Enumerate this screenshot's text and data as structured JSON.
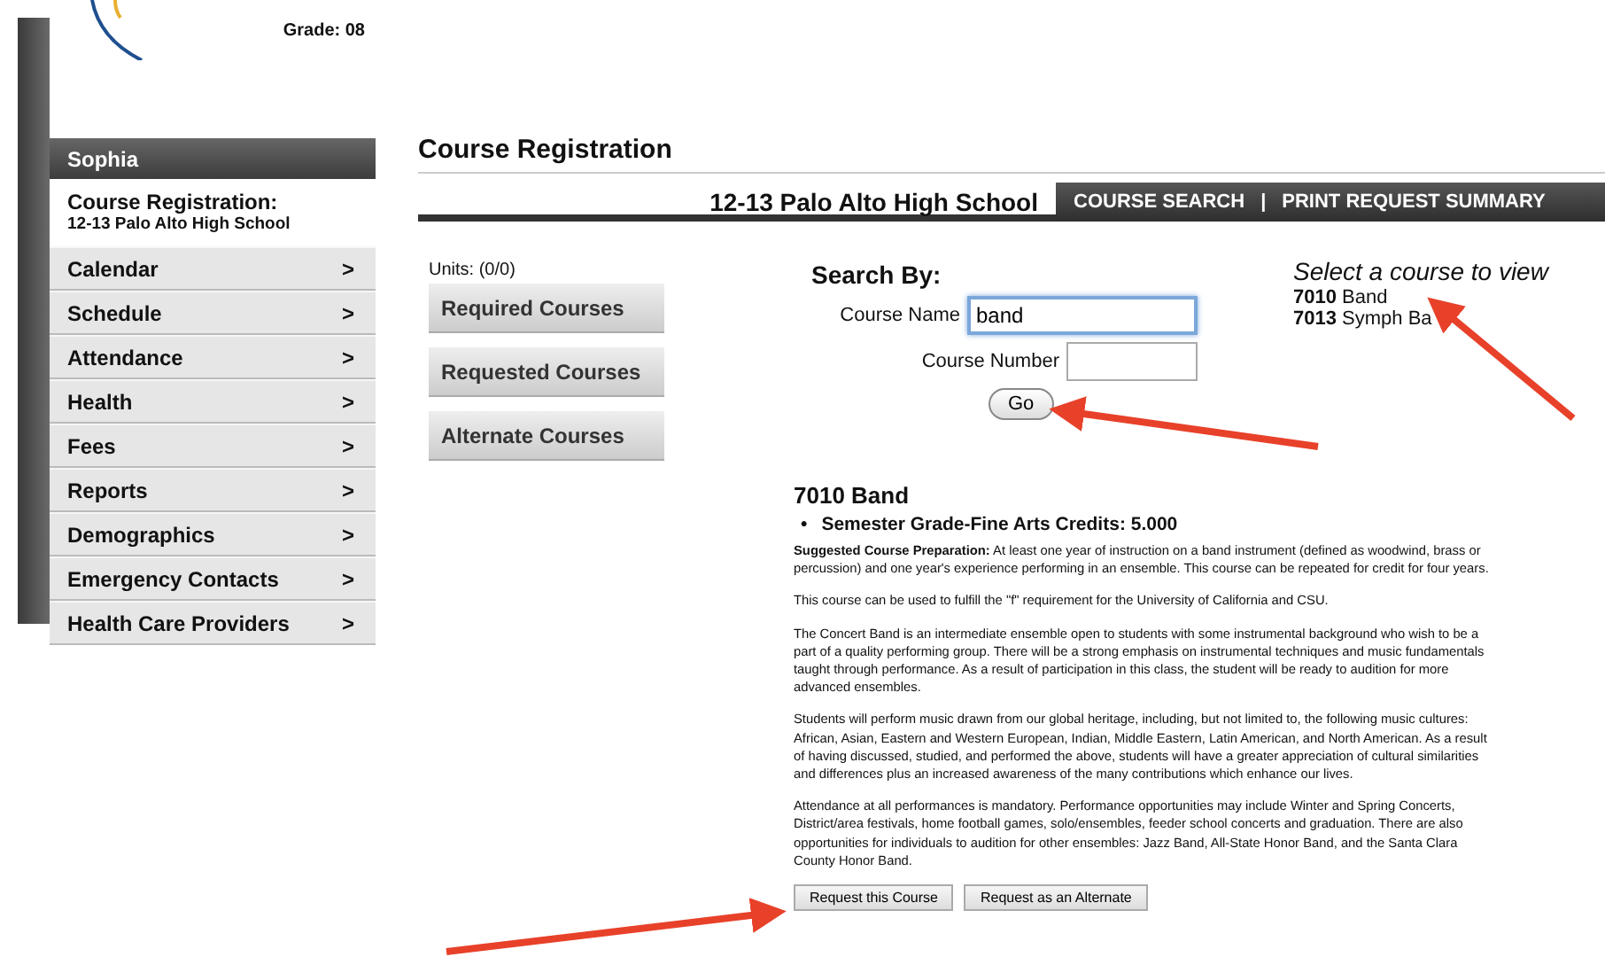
{
  "header": {
    "grade": "Grade: 08"
  },
  "sidebar": {
    "student": "Sophia",
    "current": {
      "title": "Course Registration:",
      "subtitle": "12-13 Palo Alto High School"
    },
    "items": [
      {
        "label": "Calendar",
        "chevron": ">"
      },
      {
        "label": "Schedule",
        "chevron": ">"
      },
      {
        "label": "Attendance",
        "chevron": ">"
      },
      {
        "label": "Health",
        "chevron": ">"
      },
      {
        "label": "Fees",
        "chevron": ">"
      },
      {
        "label": "Reports",
        "chevron": ">"
      },
      {
        "label": "Demographics",
        "chevron": ">"
      },
      {
        "label": "Emergency Contacts",
        "chevron": ">"
      },
      {
        "label": "Health Care Providers",
        "chevron": ">"
      }
    ]
  },
  "page_title": "Course Registration",
  "school": "12-13 Palo Alto High School",
  "nav_links": [
    {
      "label": "COURSE SEARCH"
    },
    {
      "label": "PRINT REQUEST SUMMARY"
    }
  ],
  "nav_separator": "|",
  "units": "Units: (0/0)",
  "course_lists": [
    {
      "label": "Required Courses"
    },
    {
      "label": "Requested Courses"
    },
    {
      "label": "Alternate Courses"
    }
  ],
  "search": {
    "heading": "Search By:",
    "fields": [
      {
        "label": "Course Name",
        "value": "band",
        "focused": true
      },
      {
        "label": "Course Number",
        "focused": false
      }
    ],
    "button": "Go"
  },
  "results": {
    "heading": "Select a course to view",
    "courses": [
      {
        "number": "7010",
        "name": "Band"
      },
      {
        "number": "7013",
        "name": "Symph Ba"
      }
    ]
  },
  "course_detail": {
    "title": "7010 Band",
    "bullets": [
      {
        "marker": "•",
        "text": "Semester Grade-Fine Arts Credits: 5.000"
      }
    ],
    "paragraphs": [
      "**Suggested Course Preparation:**  At least one year of instruction on a band instrument (defined as woodwind, brass or percussion) and one year's experience performing in an ensemble.  This course can be repeated for credit for four years.",
      "This course can be used to fulfill the \"f\" requirement for the University of California and CSU.",
      "The Concert Band is an intermediate ensemble open to students with some instrumental background who wish to be a part of a quality performing group.  There will be a strong emphasis on instrumental techniques and music fundamentals taught through performance.  As a result of participation in this class, the student will be ready to audition for more advanced ensembles.",
      "Students will perform music drawn from our global heritage, including, but not limited to, the following music cultures:  African, Asian, Eastern and Western European, Indian, Middle Eastern, Latin American, and North American.  As a result of having discussed, studied, and performed the above, students will have a greater appreciation of cultural similarities and differences plus an increased awareness of the many contributions which enhance our lives.",
      "Attendance at all performances is mandatory.  Performance opportunities may include Winter and Spring Concerts, District/area festivals, home football games, solo/ensembles, feeder school concerts and graduation.  There are also opportunities for individuals to audition for other ensembles:  Jazz Band, All-State Honor Band, and the Santa Clara County Honor Band."
    ],
    "buttons": [
      {
        "label": "Request this Course"
      },
      {
        "label": "Request as an Alternate"
      }
    ]
  }
}
